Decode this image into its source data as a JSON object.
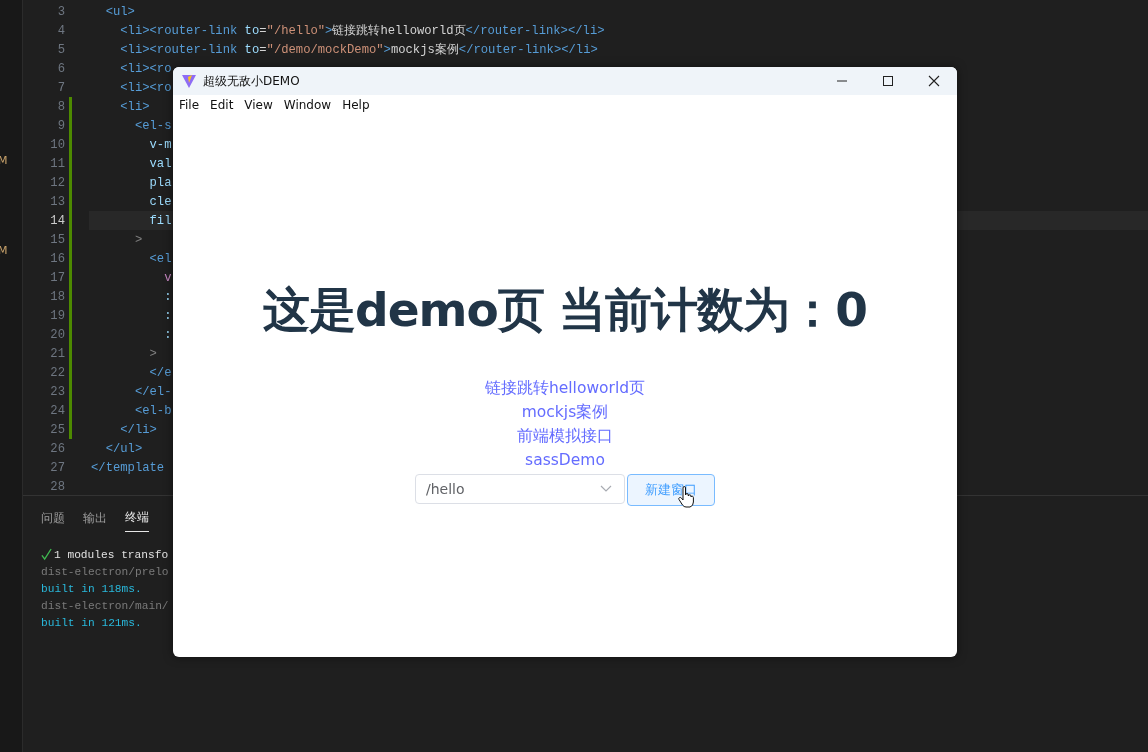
{
  "editor": {
    "markers": [
      {
        "text": "M"
      },
      {
        "text": "M"
      }
    ],
    "lines": [
      {
        "number": "3",
        "current": false,
        "tokens": [
          {
            "kind": "tag",
            "text": "  <ul>"
          }
        ]
      },
      {
        "number": "4",
        "current": false,
        "tokens": [
          {
            "kind": "tag",
            "text": "    <li><router-link "
          },
          {
            "kind": "attr",
            "text": "to"
          },
          {
            "kind": "plain",
            "text": "="
          },
          {
            "kind": "string",
            "text": "\"/hello\""
          },
          {
            "kind": "tag",
            "text": ">"
          },
          {
            "kind": "plain",
            "text": "链接跳转helloworld页"
          },
          {
            "kind": "tag",
            "text": "</router-link></li>"
          }
        ]
      },
      {
        "number": "5",
        "current": false,
        "tokens": [
          {
            "kind": "tag",
            "text": "    <li><router-link "
          },
          {
            "kind": "attr",
            "text": "to"
          },
          {
            "kind": "plain",
            "text": "="
          },
          {
            "kind": "string",
            "text": "\"/demo/mockDemo\""
          },
          {
            "kind": "tag",
            "text": ">"
          },
          {
            "kind": "plain",
            "text": "mockjs案例"
          },
          {
            "kind": "tag",
            "text": "</router-link></li>"
          }
        ]
      },
      {
        "number": "6",
        "current": false,
        "tokens": [
          {
            "kind": "tag",
            "text": "    <li><ro"
          }
        ]
      },
      {
        "number": "7",
        "current": false,
        "tokens": [
          {
            "kind": "tag",
            "text": "    <li><ro"
          }
        ]
      },
      {
        "number": "8",
        "current": false,
        "tokens": [
          {
            "kind": "tag",
            "text": "    <li>"
          }
        ]
      },
      {
        "number": "9",
        "current": false,
        "tokens": [
          {
            "kind": "tag",
            "text": "      <el-s"
          }
        ]
      },
      {
        "number": "10",
        "current": false,
        "tokens": [
          {
            "kind": "attr",
            "text": "        v-m"
          }
        ]
      },
      {
        "number": "11",
        "current": false,
        "tokens": [
          {
            "kind": "attr",
            "text": "        val"
          }
        ]
      },
      {
        "number": "12",
        "current": false,
        "tokens": [
          {
            "kind": "attr",
            "text": "        pla"
          }
        ]
      },
      {
        "number": "13",
        "current": false,
        "tokens": [
          {
            "kind": "attr",
            "text": "        cle"
          }
        ]
      },
      {
        "number": "14",
        "current": true,
        "tokens": [
          {
            "kind": "attr",
            "text": "        fil"
          }
        ]
      },
      {
        "number": "15",
        "current": false,
        "tokens": [
          {
            "kind": "punct",
            "text": "      >"
          }
        ]
      },
      {
        "number": "16",
        "current": false,
        "tokens": [
          {
            "kind": "tag",
            "text": "        <el"
          }
        ]
      },
      {
        "number": "17",
        "current": false,
        "tokens": [
          {
            "kind": "keyword",
            "text": "          v"
          }
        ]
      },
      {
        "number": "18",
        "current": false,
        "tokens": [
          {
            "kind": "attr",
            "text": "          :"
          }
        ]
      },
      {
        "number": "19",
        "current": false,
        "tokens": [
          {
            "kind": "attr",
            "text": "          :"
          }
        ]
      },
      {
        "number": "20",
        "current": false,
        "tokens": [
          {
            "kind": "attr",
            "text": "          :"
          }
        ]
      },
      {
        "number": "21",
        "current": false,
        "tokens": [
          {
            "kind": "punct",
            "text": "        >"
          }
        ]
      },
      {
        "number": "22",
        "current": false,
        "tokens": [
          {
            "kind": "tag",
            "text": "        </e"
          }
        ]
      },
      {
        "number": "23",
        "current": false,
        "tokens": [
          {
            "kind": "tag",
            "text": "      </el-"
          }
        ]
      },
      {
        "number": "24",
        "current": false,
        "tokens": [
          {
            "kind": "tag",
            "text": "      <el-b"
          }
        ]
      },
      {
        "number": "25",
        "current": false,
        "tokens": [
          {
            "kind": "tag",
            "text": "    </li>"
          }
        ]
      },
      {
        "number": "26",
        "current": false,
        "tokens": [
          {
            "kind": "tag",
            "text": "  </ul>"
          }
        ]
      },
      {
        "number": "27",
        "current": false,
        "tokens": [
          {
            "kind": "tag",
            "text": "</template"
          }
        ]
      },
      {
        "number": "28",
        "current": false
      }
    ]
  },
  "panel": {
    "tabs": [
      {
        "label": "问题",
        "selected": false
      },
      {
        "label": "输出",
        "selected": false
      },
      {
        "label": "终端",
        "selected": true
      }
    ],
    "terminal": [
      {
        "kind": "success",
        "text": "1 modules transfo"
      },
      {
        "kind": "dim",
        "text": "dist-electron/prelo"
      },
      {
        "kind": "info",
        "text": "built in 118ms."
      },
      {
        "kind": "dim",
        "text": "dist-electron/main/"
      },
      {
        "kind": "info",
        "text": "built in 121ms."
      }
    ]
  },
  "app_window": {
    "title": "超级无敌小DEMO",
    "menu": [
      "File",
      "Edit",
      "View",
      "Window",
      "Help"
    ],
    "heading": "这是demo页 当前计数为：0",
    "links": [
      "链接跳转helloworld页",
      "mockjs案例",
      "前端模拟接口",
      "sassDemo"
    ],
    "select": {
      "value": "/hello"
    },
    "button": "新建窗口"
  }
}
